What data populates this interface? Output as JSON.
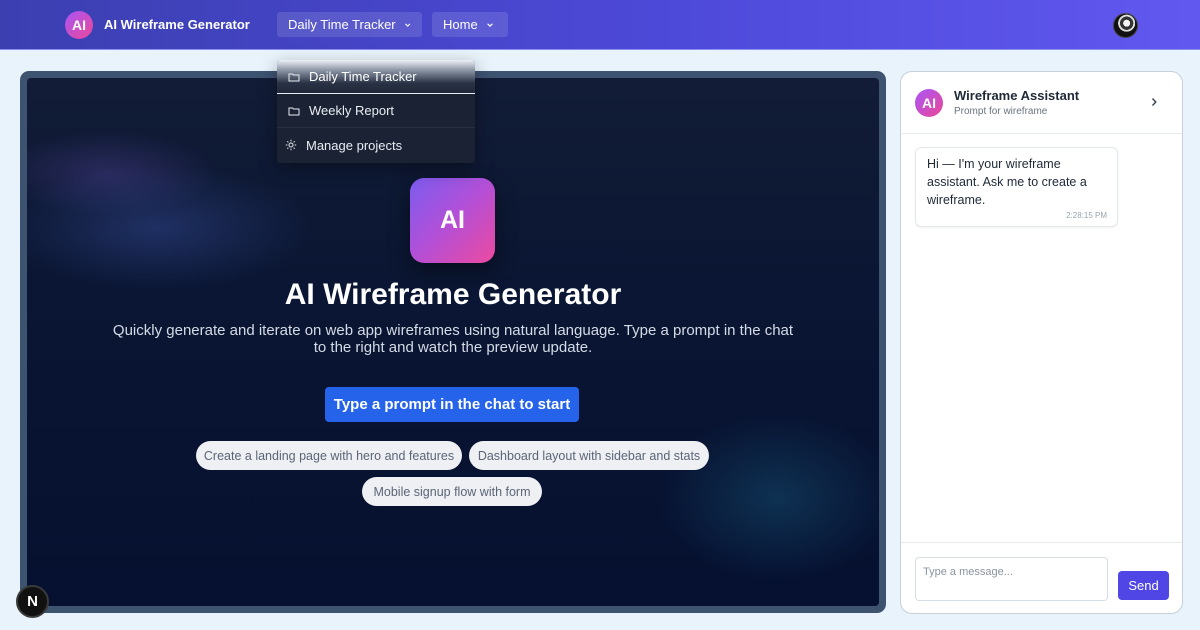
{
  "header": {
    "logo_text": "AI",
    "brand_name": "AI Wireframe Generator",
    "project_select": "Daily Time Tracker",
    "nav_home": "Home"
  },
  "dropdown": {
    "items": [
      {
        "label": "Daily Time Tracker",
        "icon": "folder-icon"
      },
      {
        "label": "Weekly Report",
        "icon": "folder-icon"
      },
      {
        "label": "Manage projects",
        "icon": "settings-icon"
      }
    ]
  },
  "preview": {
    "icon_text": "AI",
    "title": "AI Wireframe Generator",
    "subtitle": "Quickly generate and iterate on web app wireframes using natural language. Type a prompt in the chat to the right and watch the preview update.",
    "cta": "Type a prompt in the chat to start",
    "suggestions": [
      "Create a landing page with hero and features",
      "Dashboard layout with sidebar and stats",
      "Mobile signup flow with form"
    ]
  },
  "chat": {
    "logo_text": "AI",
    "title": "Wireframe Assistant",
    "subtitle": "Prompt for wireframe",
    "messages": [
      {
        "text": "Hi — I'm your wireframe assistant. Ask me to create a wireframe.",
        "time": "2:28:15 PM"
      }
    ],
    "input_placeholder": "Type a message...",
    "send_label": "Send"
  },
  "corner_badge": "N",
  "colors": {
    "topbar": "#4d49d8",
    "cta": "#2563eb",
    "send": "#4f46e5",
    "preview_bg": "#0a1633",
    "accent_gradient_start": "#a855f7",
    "accent_gradient_end": "#ec4899"
  }
}
